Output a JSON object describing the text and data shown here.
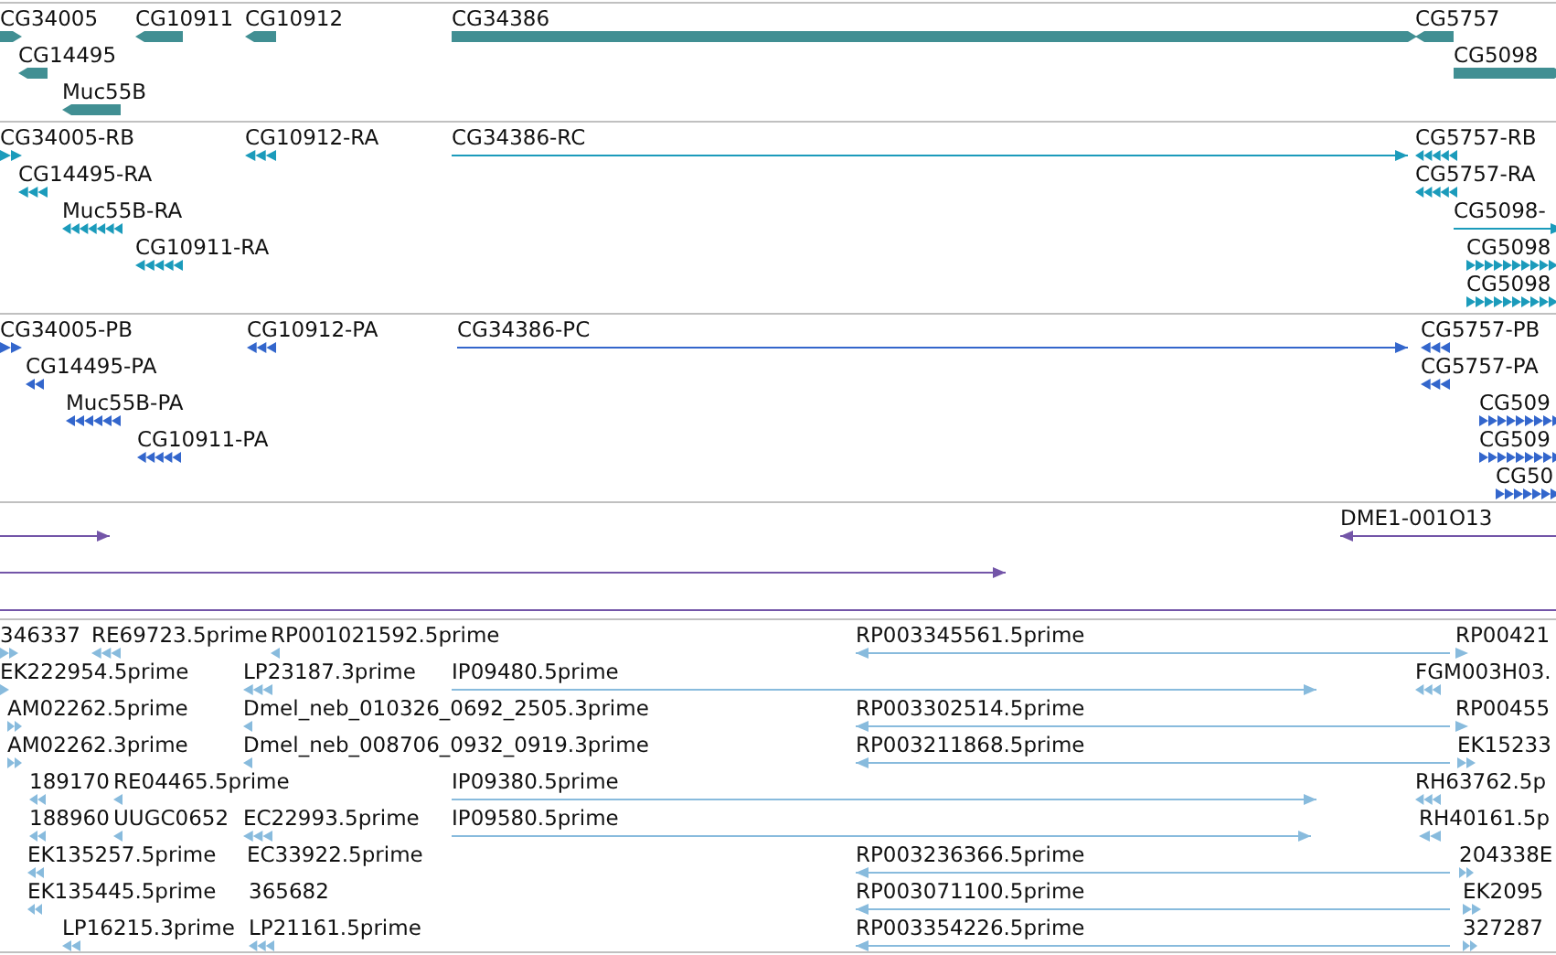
{
  "tracks": [
    {
      "color": "#418f93",
      "features": [
        {
          "label": "CG34005",
          "reverse": false
        },
        {
          "label": "CG10911",
          "reverse": true
        },
        {
          "label": "CG10912",
          "reverse": true
        },
        {
          "label": "CG34386",
          "reverse": false
        },
        {
          "label": "CG5757",
          "reverse": true
        },
        {
          "label": "CG14495",
          "reverse": true
        },
        {
          "label": "CG5098",
          "reverse": false
        },
        {
          "label": "Muc55B",
          "reverse": true
        }
      ]
    },
    {
      "color": "#1b9bbb",
      "features": [
        {
          "label": "CG34005-RB",
          "reverse": false
        },
        {
          "label": "CG10912-RA",
          "reverse": true
        },
        {
          "label": "CG34386-RC",
          "reverse": false
        },
        {
          "label": "CG5757-RB",
          "reverse": true
        },
        {
          "label": "CG14495-RA",
          "reverse": true
        },
        {
          "label": "CG5757-RA",
          "reverse": true
        },
        {
          "label": "Muc55B-RA",
          "reverse": true
        },
        {
          "label": "CG5098-",
          "reverse": false
        },
        {
          "label": "CG10911-RA",
          "reverse": true
        },
        {
          "label": "CG5098",
          "reverse": false
        },
        {
          "label": "CG5098",
          "reverse": false
        }
      ]
    },
    {
      "color": "#3366cc",
      "features": [
        {
          "label": "CG34005-PB",
          "reverse": false
        },
        {
          "label": "CG10912-PA",
          "reverse": true
        },
        {
          "label": "CG34386-PC",
          "reverse": false
        },
        {
          "label": "CG5757-PB",
          "reverse": true
        },
        {
          "label": "CG14495-PA",
          "reverse": true
        },
        {
          "label": "CG5757-PA",
          "reverse": true
        },
        {
          "label": "Muc55B-PA",
          "reverse": true
        },
        {
          "label": "CG509",
          "reverse": false
        },
        {
          "label": "CG10911-PA",
          "reverse": true
        },
        {
          "label": "CG509",
          "reverse": false
        },
        {
          "label": "CG50",
          "reverse": false
        }
      ]
    },
    {
      "color": "#7355a8",
      "features": [
        {
          "reverse": false
        },
        {
          "label": "DME1-001O13",
          "reverse": true
        },
        {
          "reverse": false
        }
      ]
    },
    {
      "color": "#88bbdd",
      "features": [
        {
          "label": "346337",
          "reverse": false
        },
        {
          "label": "RE69723.5prime",
          "reverse": true
        },
        {
          "label": "RP001021592.5prime",
          "reverse": true
        },
        {
          "label": "RP003345561.5prime",
          "reverse": true
        },
        {
          "label": "RP00421",
          "reverse": false
        },
        {
          "label": "EK222954.5prime",
          "reverse": false
        },
        {
          "label": "LP23187.3prime",
          "reverse": true
        },
        {
          "label": "IP09480.5prime",
          "reverse": false
        },
        {
          "label": "FGM003H03.",
          "reverse": true
        },
        {
          "label": "AM02262.5prime",
          "reverse": false
        },
        {
          "label": "Dmel_neb_010326_0692_2505.3prime",
          "reverse": true
        },
        {
          "label": "RP003302514.5prime",
          "reverse": true
        },
        {
          "label": "RP00455",
          "reverse": false
        },
        {
          "label": "AM02262.3prime",
          "reverse": false
        },
        {
          "label": "Dmel_neb_008706_0932_0919.3prime",
          "reverse": true
        },
        {
          "label": "RP003211868.5prime",
          "reverse": true
        },
        {
          "label": "EK15233",
          "reverse": false
        },
        {
          "label": "189170",
          "reverse": true
        },
        {
          "label": "RE04465.5prime",
          "reverse": true
        },
        {
          "label": "IP09380.5prime",
          "reverse": false
        },
        {
          "label": "RH63762.5p",
          "reverse": true
        },
        {
          "label": "188960",
          "reverse": true
        },
        {
          "label": "UUGC0652",
          "reverse": true
        },
        {
          "label": "EC22993.5prime",
          "reverse": true
        },
        {
          "label": "IP09580.5prime",
          "reverse": false
        },
        {
          "label": "RH40161.5p",
          "reverse": true
        },
        {
          "label": "EK135257.5prime",
          "reverse": true
        },
        {
          "label": "EC33922.5prime"
        },
        {
          "label": "RP003236366.5prime",
          "reverse": true
        },
        {
          "label": "204338E",
          "reverse": false
        },
        {
          "label": "EK135445.5prime",
          "reverse": true
        },
        {
          "label": "365682"
        },
        {
          "label": "RP003071100.5prime",
          "reverse": true
        },
        {
          "label": "EK2095",
          "reverse": false
        },
        {
          "label": "LP16215.3prime",
          "reverse": true
        },
        {
          "label": "LP21161.5prime",
          "reverse": true
        },
        {
          "label": "RP003354226.5prime",
          "reverse": true
        },
        {
          "label": "327287",
          "reverse": false
        }
      ]
    }
  ]
}
